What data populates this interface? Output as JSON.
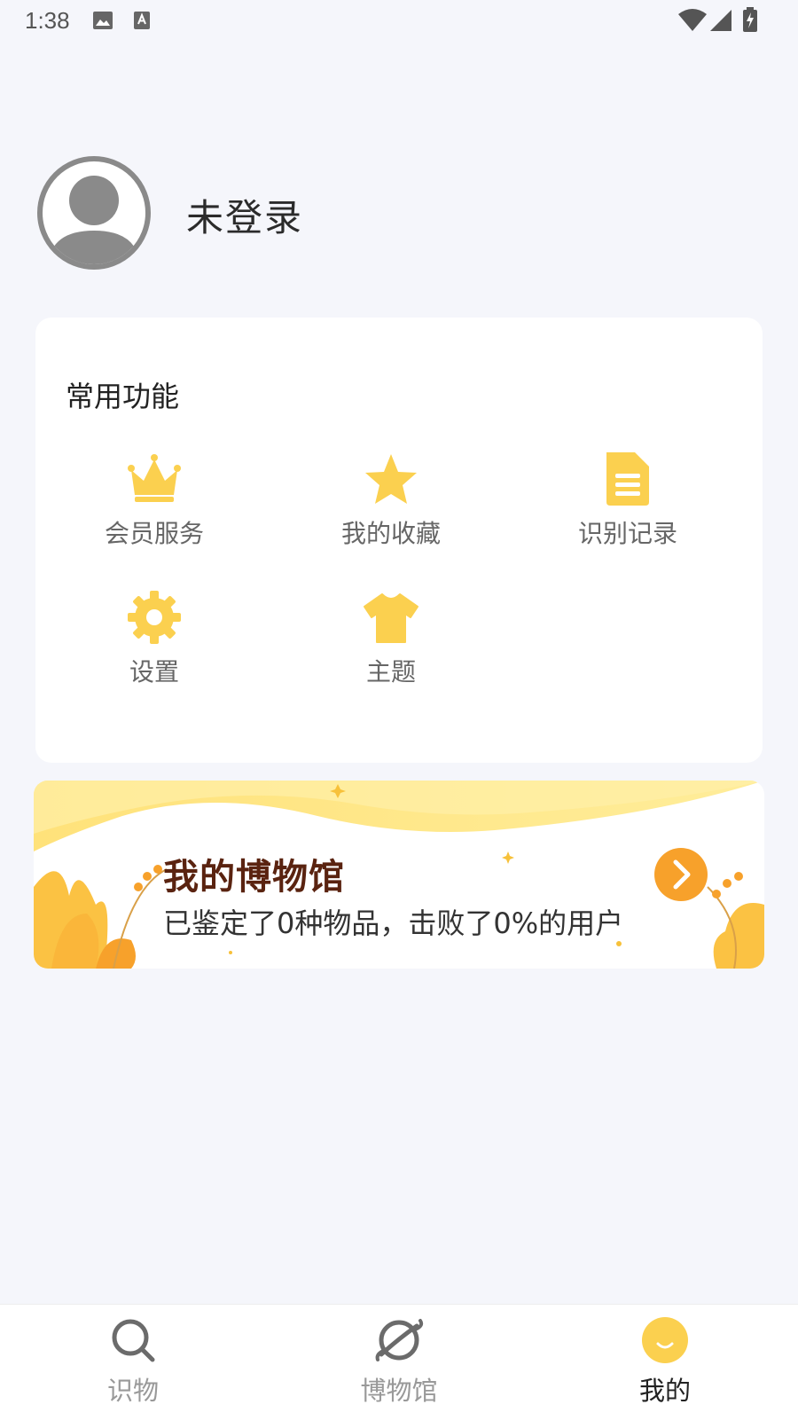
{
  "status_bar": {
    "time": "1:38"
  },
  "profile": {
    "username": "未登录"
  },
  "functions": {
    "title": "常用功能",
    "accent_color": "#fbd04f",
    "items": [
      {
        "label": "会员服务",
        "icon": "crown-icon"
      },
      {
        "label": "我的收藏",
        "icon": "star-icon"
      },
      {
        "label": "识别记录",
        "icon": "document-icon"
      },
      {
        "label": "设置",
        "icon": "gear-icon"
      },
      {
        "label": "主题",
        "icon": "tshirt-icon"
      }
    ]
  },
  "museum_banner": {
    "title": "我的博物馆",
    "subtitle": "已鉴定了0种物品，击败了0%的用户",
    "arrow_color": "#f7a12b"
  },
  "bottom_nav": {
    "items": [
      {
        "label": "识物",
        "icon": "search-icon",
        "active": false
      },
      {
        "label": "博物馆",
        "icon": "planet-icon",
        "active": false
      },
      {
        "label": "我的",
        "icon": "smile-face-icon",
        "active": true
      }
    ]
  }
}
